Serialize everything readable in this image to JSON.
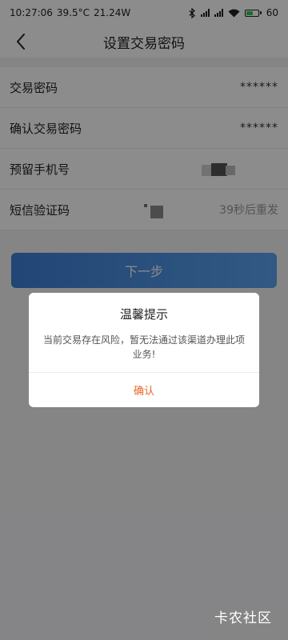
{
  "status_bar": {
    "time": "10:27:06",
    "temperature": "39.5°C",
    "speed": "21.24W",
    "battery_level": "60",
    "icons": [
      "bluetooth-icon",
      "signal-icon",
      "signal-icon",
      "wifi-icon",
      "battery-icon"
    ]
  },
  "header": {
    "title": "设置交易密码",
    "back_icon": "chevron-left-icon"
  },
  "form": {
    "rows": [
      {
        "label": "交易密码",
        "value": "******"
      },
      {
        "label": "确认交易密码",
        "value": "******"
      },
      {
        "label": "预留手机号"
      },
      {
        "label": "短信验证码",
        "countdown": "39秒后重发"
      }
    ]
  },
  "next_button": {
    "label": "下一步"
  },
  "dialog": {
    "title": "温馨提示",
    "message": "当前交易存在风险，暂无法通过该渠道办理此项业务!",
    "confirm_label": "确认"
  },
  "watermark": "卡农社区",
  "colors": {
    "accent": "#4a90e2",
    "dialog_confirm": "#e8672c",
    "overlay": "rgba(0,0,0,0.45)"
  }
}
